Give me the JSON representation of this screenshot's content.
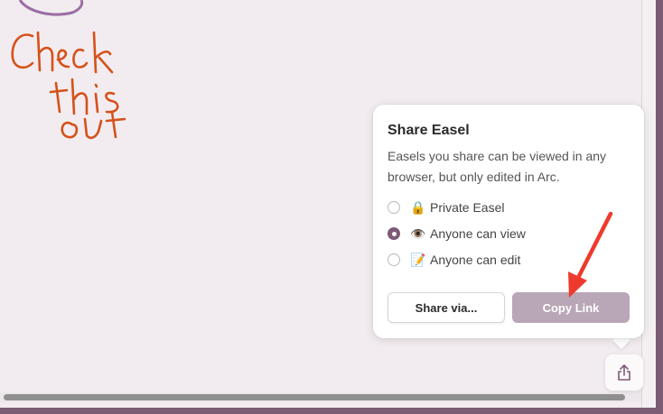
{
  "canvas": {
    "handwriting_note": "Check this out"
  },
  "popover": {
    "title": "Share Easel",
    "description": "Easels you share can be viewed in any browser, but only edited in Arc.",
    "options": [
      {
        "emoji": "🔒",
        "label": "Private Easel",
        "selected": false
      },
      {
        "emoji": "👁️",
        "label": "Anyone can view",
        "selected": true
      },
      {
        "emoji": "📝",
        "label": "Anyone can edit",
        "selected": false
      }
    ],
    "share_via_label": "Share via...",
    "copy_link_label": "Copy Link"
  },
  "toolbar": {
    "share_icon": "share-icon"
  },
  "colors": {
    "accent": "#7d5a78",
    "copy_button": "#b9a6b6",
    "annotation_arrow": "#ee3a2c",
    "handwriting": "#d5511a",
    "frame": "#7a5c74"
  }
}
